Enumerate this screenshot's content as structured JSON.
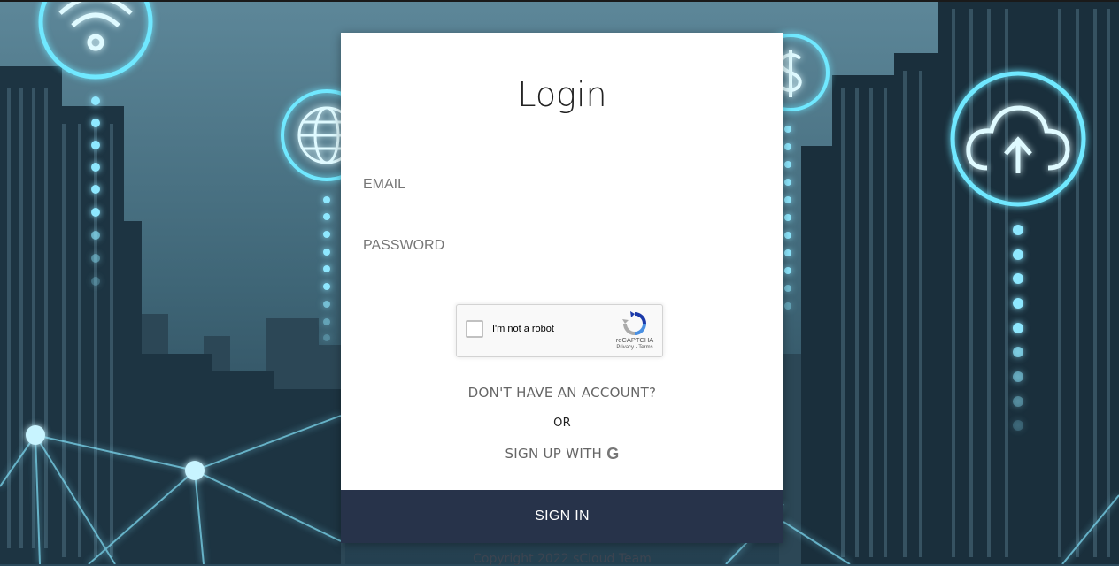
{
  "login": {
    "title": "Login",
    "email_placeholder": "EMAIL",
    "password_placeholder": "PASSWORD",
    "captcha": {
      "label": "I'm not a robot",
      "brand": "reCAPTCHA",
      "links": "Privacy - Terms"
    },
    "no_account": "DON'T HAVE AN ACCOUNT?",
    "or": "OR",
    "signup_with": "SIGN UP WITH",
    "signup_icon": "G",
    "signin": "SIGN IN"
  },
  "footer": {
    "text": "Copyright 2022 sCloud Team"
  },
  "background": {
    "icons": [
      "wifi-icon",
      "globe-icon",
      "dollar-icon",
      "cloud-upload-icon"
    ],
    "colors": {
      "glow": "#5fe6ff",
      "sky": "#4a7488",
      "buildings": "#1d3442"
    }
  },
  "colors": {
    "signin_button": "#27334a",
    "card": "#ffffff"
  }
}
